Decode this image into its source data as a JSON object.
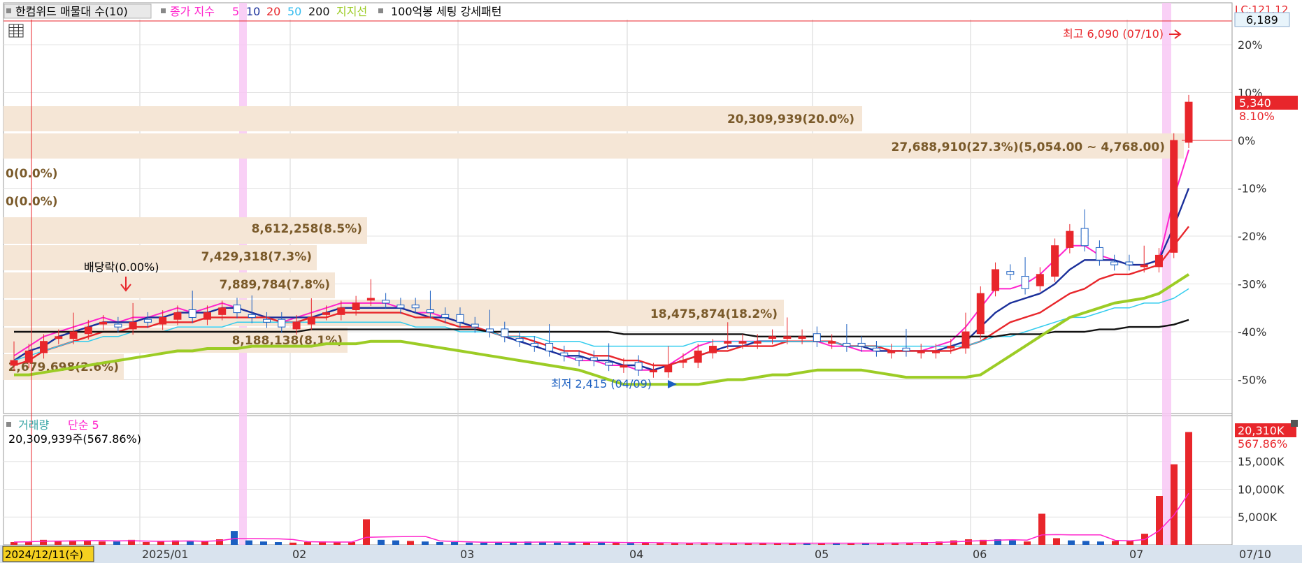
{
  "legend": {
    "title": "한컴위드 매물대 수(10)",
    "ma_label": "종가 지수",
    "ma_periods": [
      "5",
      "10",
      "20",
      "50",
      "200"
    ],
    "support_label": "지지선",
    "pattern_label": "100억봉 세팅 강세패턴"
  },
  "volume_legend": {
    "label": "거래량",
    "ma_label": "단순 5",
    "current": "20,309,939주(567.86%)"
  },
  "price_axis": {
    "ticks": [
      "20%",
      "10%",
      "0%",
      "-10%",
      "-20%",
      "-30%",
      "-40%",
      "-50%"
    ],
    "top_badge": "6,189",
    "top_label": "LC:121.12",
    "current_price": "5,340",
    "current_change": "8.10%"
  },
  "volume_axis": {
    "ticks": [
      "15,000K",
      "10,000K",
      "5,000K"
    ],
    "current_badge": "20,310K",
    "current_pct": "567.86%"
  },
  "time_axis": {
    "start_label": "2024/12/11(수)",
    "months": [
      "2025/01",
      "02",
      "03",
      "04",
      "05",
      "06",
      "07"
    ],
    "end_label": "07/10"
  },
  "annotations": {
    "high": "최고 6,090 (07/10)",
    "low": "최저 2,415 (04/09)",
    "dividend": "배당락(0.00%)"
  },
  "volume_profile": [
    "20,309,939(20.0%)",
    "27,688,910(27.3%)(5,054.00 ~ 4,768.00)",
    "0(0.0%)",
    "0(0.0%)",
    "8,612,258(8.5%)",
    "7,429,318(7.3%)",
    "7,889,784(7.8%)",
    "18,475,874(18.2%)",
    "8,188,138(8.1%)",
    "2,679,698(2.6%)"
  ],
  "chart_data": {
    "type": "candlestick",
    "y_unit": "% from reference close",
    "ylim": [
      -53,
      25
    ],
    "series": [
      {
        "name": "종가",
        "values": [
          -46,
          -44,
          -42,
          -41,
          -40,
          -39,
          -38,
          -39,
          -38,
          -38,
          -37,
          -36,
          -37,
          -36,
          -35,
          -36,
          -37,
          -38,
          -39,
          -38,
          -37,
          -36,
          -35,
          -34,
          -33,
          -34,
          -35,
          -35,
          -36,
          -37,
          -38,
          -39,
          -40,
          -41,
          -42,
          -43,
          -44,
          -45,
          -46,
          -46,
          -47,
          -47,
          -48,
          -48,
          -47,
          -46,
          -44,
          -43,
          -42,
          -42,
          -42,
          -41,
          -41,
          -41,
          -42,
          -42,
          -43,
          -43,
          -44,
          -44,
          -44,
          -44,
          -44,
          -43,
          -40,
          -32,
          -27,
          -28,
          -31,
          -28,
          -22,
          -19,
          -22,
          -25,
          -26,
          -26,
          -26,
          -24,
          0,
          8
        ]
      },
      {
        "name": "5",
        "values": [
          -45,
          -43,
          -41,
          -40,
          -39,
          -38,
          -37,
          -38,
          -37,
          -37,
          -36,
          -35,
          -36,
          -35,
          -34,
          -35,
          -36,
          -37,
          -38,
          -37,
          -36,
          -35,
          -34,
          -34,
          -34,
          -34,
          -35,
          -36,
          -36,
          -37,
          -38,
          -39,
          -40,
          -41,
          -42,
          -43,
          -44,
          -45,
          -46,
          -46,
          -47,
          -47,
          -48,
          -48,
          -47,
          -45,
          -43,
          -42,
          -42,
          -42,
          -42,
          -42,
          -42,
          -42,
          -42,
          -43,
          -43,
          -44,
          -44,
          -44,
          -44,
          -44,
          -43,
          -42,
          -39,
          -35,
          -31,
          -31,
          -30,
          -28,
          -25,
          -22,
          -22,
          -24,
          -25,
          -26,
          -26,
          -25,
          -12,
          -2
        ]
      },
      {
        "name": "10",
        "values": [
          -46,
          -44,
          -43,
          -41,
          -40,
          -39,
          -38,
          -38,
          -38,
          -37,
          -37,
          -36,
          -36,
          -36,
          -35,
          -35,
          -36,
          -37,
          -37,
          -37,
          -37,
          -36,
          -35,
          -35,
          -35,
          -35,
          -35,
          -36,
          -37,
          -37,
          -38,
          -39,
          -40,
          -41,
          -42,
          -43,
          -44,
          -45,
          -45,
          -46,
          -46,
          -47,
          -47,
          -48,
          -47,
          -46,
          -45,
          -44,
          -43,
          -43,
          -42,
          -42,
          -42,
          -42,
          -42,
          -42,
          -43,
          -43,
          -44,
          -44,
          -44,
          -44,
          -44,
          -43,
          -42,
          -39,
          -36,
          -34,
          -33,
          -32,
          -30,
          -27,
          -25,
          -25,
          -25,
          -26,
          -26,
          -25,
          -18,
          -10
        ]
      },
      {
        "name": "20",
        "values": [
          -47,
          -46,
          -44,
          -43,
          -42,
          -41,
          -40,
          -40,
          -39,
          -39,
          -38,
          -38,
          -38,
          -37,
          -37,
          -37,
          -37,
          -37,
          -38,
          -38,
          -37,
          -37,
          -36,
          -36,
          -36,
          -36,
          -36,
          -37,
          -37,
          -38,
          -39,
          -39,
          -40,
          -41,
          -41,
          -42,
          -43,
          -44,
          -44,
          -45,
          -45,
          -46,
          -46,
          -47,
          -47,
          -46,
          -45,
          -44,
          -44,
          -43,
          -43,
          -43,
          -42,
          -42,
          -42,
          -42,
          -43,
          -43,
          -43,
          -44,
          -44,
          -44,
          -44,
          -44,
          -43,
          -42,
          -40,
          -38,
          -37,
          -36,
          -34,
          -32,
          -31,
          -29,
          -28,
          -28,
          -27,
          -26,
          -22,
          -18
        ]
      },
      {
        "name": "50",
        "values": [
          -46,
          -45,
          -44,
          -43,
          -42,
          -42,
          -41,
          -41,
          -40,
          -40,
          -40,
          -39,
          -39,
          -39,
          -39,
          -38,
          -38,
          -38,
          -38,
          -38,
          -38,
          -38,
          -38,
          -38,
          -38,
          -38,
          -38,
          -39,
          -39,
          -39,
          -40,
          -40,
          -40,
          -41,
          -41,
          -41,
          -42,
          -42,
          -42,
          -43,
          -43,
          -43,
          -43,
          -43,
          -43,
          -43,
          -42,
          -42,
          -42,
          -42,
          -42,
          -42,
          -42,
          -42,
          -42,
          -42,
          -43,
          -43,
          -43,
          -43,
          -43,
          -43,
          -43,
          -43,
          -43,
          -42,
          -41,
          -41,
          -40,
          -39,
          -38,
          -37,
          -37,
          -36,
          -35,
          -35,
          -34,
          -34,
          -33,
          -31
        ]
      },
      {
        "name": "200",
        "values": [
          -40,
          -40,
          -40,
          -40,
          -40,
          -40,
          -40,
          -40,
          -40,
          -40,
          -40,
          -40,
          -40,
          -40,
          -40,
          -40,
          -40,
          -40,
          -40,
          -40,
          -39.5,
          -39.5,
          -39.5,
          -39.5,
          -39.5,
          -39.5,
          -39.5,
          -39.5,
          -39.5,
          -39.5,
          -39.5,
          -39.5,
          -40,
          -40,
          -40,
          -40,
          -40,
          -40,
          -40,
          -40,
          -40,
          -40.5,
          -40.5,
          -40.5,
          -40.5,
          -40.5,
          -40.5,
          -40.5,
          -40.5,
          -40.5,
          -41,
          -41,
          -41,
          -41,
          -41,
          -41,
          -41,
          -41,
          -41,
          -41,
          -41,
          -41,
          -41,
          -41,
          -41,
          -41,
          -41,
          -40.5,
          -40.5,
          -40.5,
          -40,
          -40,
          -40,
          -39.5,
          -39.5,
          -39,
          -39,
          -39,
          -38.5,
          -37.5
        ]
      },
      {
        "name": "지지선",
        "values": [
          -49,
          -49,
          -48.5,
          -48,
          -47.5,
          -47,
          -46.5,
          -46,
          -45.5,
          -45,
          -44.5,
          -44,
          -44,
          -43.5,
          -43.5,
          -43.5,
          -43,
          -43,
          -43,
          -43,
          -43,
          -42.5,
          -42.5,
          -42.5,
          -42,
          -42,
          -42,
          -42.5,
          -43,
          -43.5,
          -44,
          -44.5,
          -45,
          -45.5,
          -46,
          -46.5,
          -47,
          -47.5,
          -48,
          -49,
          -50,
          -51,
          -51,
          -51,
          -51,
          -51,
          -51,
          -50.5,
          -50,
          -50,
          -49.5,
          -49,
          -49,
          -48.5,
          -48,
          -48,
          -48,
          -48,
          -48.5,
          -49,
          -49.5,
          -49.5,
          -49.5,
          -49.5,
          -49.5,
          -49,
          -47,
          -45,
          -43,
          -41,
          -39,
          -37,
          -36,
          -35,
          -34,
          -33.5,
          -33,
          -32,
          -30,
          -28
        ]
      }
    ],
    "volume_unit": "K",
    "volume": [
      500,
      600,
      900,
      700,
      800,
      800,
      600,
      600,
      900,
      500,
      600,
      800,
      700,
      600,
      1000,
      2500,
      800,
      600,
      500,
      400,
      500,
      600,
      500,
      500,
      4600,
      900,
      800,
      700,
      600,
      500,
      500,
      400,
      400,
      500,
      500,
      600,
      500,
      400,
      400,
      500,
      500,
      400,
      300,
      400,
      300,
      300,
      300,
      400,
      300,
      300,
      300,
      300,
      300,
      300,
      300,
      300,
      300,
      300,
      300,
      300,
      400,
      400,
      500,
      600,
      800,
      1000,
      900,
      1000,
      800,
      600,
      5600,
      1200,
      800,
      700,
      600,
      700,
      800,
      2000,
      8800,
      14500,
      20310
    ]
  }
}
